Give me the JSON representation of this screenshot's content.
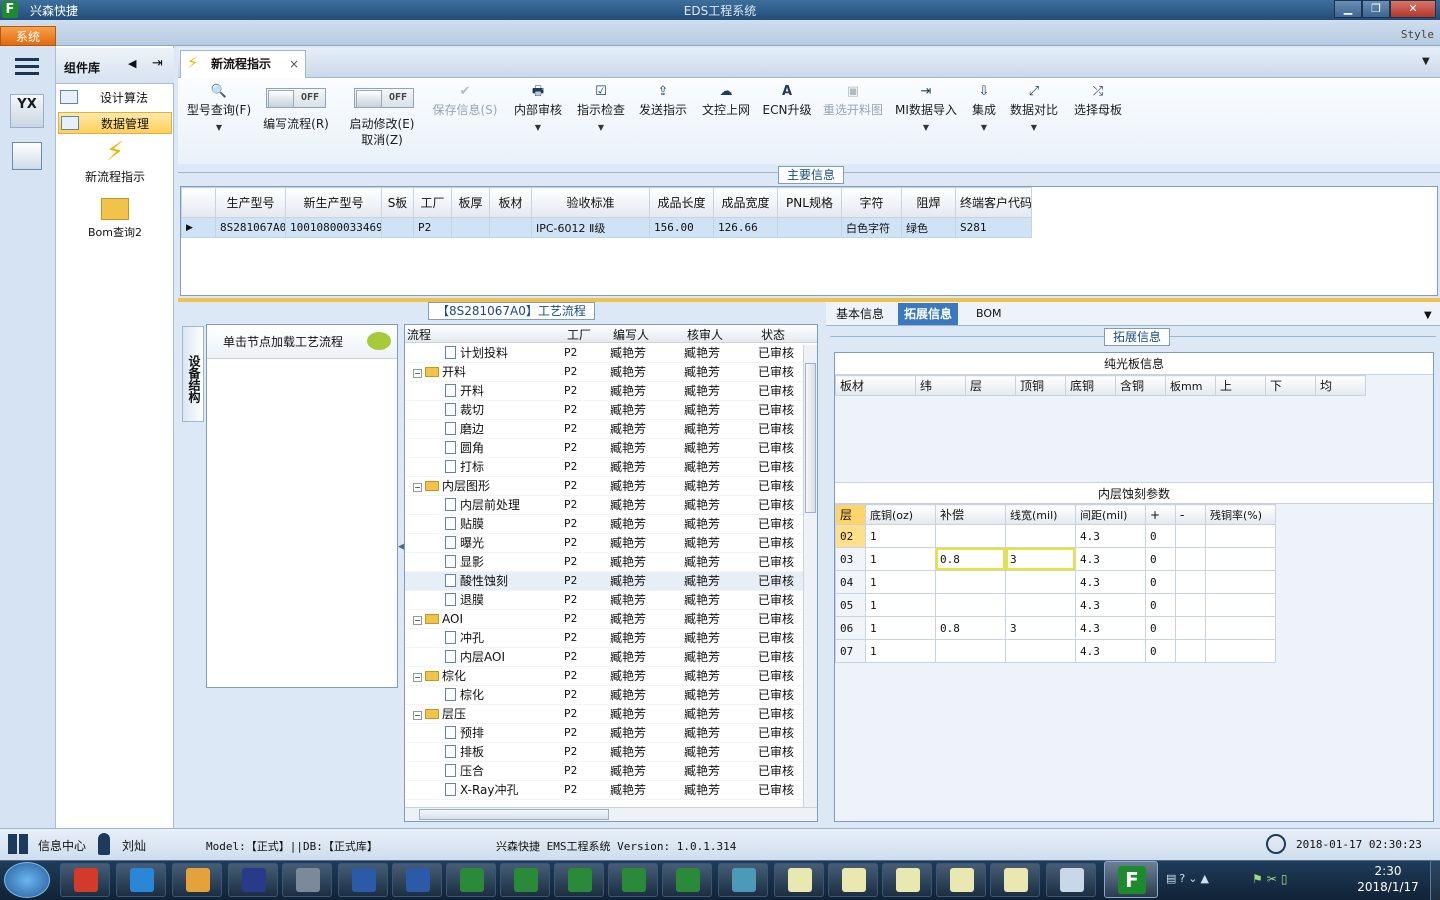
{
  "window": {
    "app_title": "兴森快捷",
    "center_title": "EDS工程系统",
    "icon_letter": "F"
  },
  "menubar": {
    "system_label": "系统",
    "style_label": "Style"
  },
  "left_rail": {
    "logo_text": "YX"
  },
  "component_panel": {
    "title": "组件库",
    "items": [
      {
        "label": "设计算法"
      },
      {
        "label": "数据管理"
      }
    ],
    "shortcuts": [
      {
        "label": "新流程指示"
      },
      {
        "label": "Bom查询2"
      }
    ]
  },
  "doc_tab": {
    "label": "新流程指示",
    "close": "×"
  },
  "ribbon": {
    "buttons": [
      {
        "label": "型号查询(F)",
        "icon": "🔍"
      },
      {
        "label": "编写流程(R)",
        "toggle": "OFF"
      },
      {
        "label": "启动修改(E)",
        "sub": "取消(Z)",
        "toggle": "OFF"
      },
      {
        "label": "保存信息(S)",
        "icon": "✔"
      },
      {
        "label": "内部审核",
        "icon": "🖶"
      },
      {
        "label": "指示检查",
        "icon": "☑"
      },
      {
        "label": "发送指示",
        "icon": "⇪"
      },
      {
        "label": "文控上网",
        "icon": "☁"
      },
      {
        "label": "ECN升级",
        "icon": "A"
      },
      {
        "label": "重选开料图",
        "icon": "▣"
      },
      {
        "label": "MI数据导入",
        "icon": "⇥"
      },
      {
        "label": "集成",
        "icon": "⇩"
      },
      {
        "label": "数据对比",
        "icon": "⤢"
      },
      {
        "label": "选择母板",
        "icon": "⤮"
      }
    ]
  },
  "main_info": {
    "title": "主要信息",
    "columns": [
      "生产型号",
      "新生产型号",
      "S板",
      "工厂",
      "板厚",
      "板材",
      "验收标准",
      "成品长度",
      "成品宽度",
      "PNL规格",
      "字符",
      "阻焊",
      "终端客户代码"
    ],
    "row": [
      "8S281067A0",
      "10010800033469",
      "",
      "P2",
      "",
      "",
      "IPC-6012 Ⅱ级",
      "156.00",
      "126.66",
      "",
      "白色字符",
      "绿色",
      "S281"
    ]
  },
  "process": {
    "title": "【8S281067A0】工艺流程",
    "side_tab": "设备结构",
    "hint": "单击节点加载工艺流程",
    "columns": [
      "流程",
      "工厂",
      "编写人",
      "核审人",
      "状态"
    ],
    "factory": "P2",
    "writer": "臧艳芳",
    "reviewer": "臧艳芳",
    "status": "已审核",
    "rows": [
      {
        "name": "计划投料",
        "level": 1
      },
      {
        "name": "开料",
        "level": 0
      },
      {
        "name": "开料",
        "level": 1
      },
      {
        "name": "裁切",
        "level": 1
      },
      {
        "name": "磨边",
        "level": 1
      },
      {
        "name": "圆角",
        "level": 1
      },
      {
        "name": "打标",
        "level": 1
      },
      {
        "name": "内层图形",
        "level": 0
      },
      {
        "name": "内层前处理",
        "level": 1
      },
      {
        "name": "贴膜",
        "level": 1
      },
      {
        "name": "曝光",
        "level": 1
      },
      {
        "name": "显影",
        "level": 1
      },
      {
        "name": "酸性蚀刻",
        "level": 1,
        "selected": true
      },
      {
        "name": "退膜",
        "level": 1
      },
      {
        "name": "AOI",
        "level": 0
      },
      {
        "name": "冲孔",
        "level": 1
      },
      {
        "name": "内层AOI",
        "level": 1
      },
      {
        "name": "棕化",
        "level": 0
      },
      {
        "name": "棕化",
        "level": 1
      },
      {
        "name": "层压",
        "level": 0
      },
      {
        "name": "预排",
        "level": 1
      },
      {
        "name": "排板",
        "level": 1
      },
      {
        "name": "压合",
        "level": 1
      },
      {
        "name": "X-Ray冲孔",
        "level": 1
      }
    ]
  },
  "right_tabs": [
    {
      "label": "基本信息"
    },
    {
      "label": "拓展信息",
      "active": true
    },
    {
      "label": "BOM"
    }
  ],
  "ext": {
    "title": "拓展信息",
    "pure": {
      "title": "纯光板信息",
      "columns": [
        "板材",
        "纬",
        "层",
        "顶铜",
        "底铜",
        "含铜",
        "板mm",
        "上",
        "下",
        "均"
      ]
    },
    "etch": {
      "title": "内层蚀刻参数",
      "columns": [
        "层",
        "底铜(oz)",
        "补偿",
        "线宽(mil)",
        "间距(mil)",
        "+",
        "-",
        "残铜率(%)"
      ],
      "rows": [
        [
          "02",
          "1",
          "",
          "",
          "4.3",
          "0",
          "",
          ""
        ],
        [
          "03",
          "1",
          "0.8",
          "3",
          "4.3",
          "0",
          "",
          ""
        ],
        [
          "04",
          "1",
          "",
          "",
          "4.3",
          "0",
          "",
          ""
        ],
        [
          "05",
          "1",
          "",
          "",
          "4.3",
          "0",
          "",
          ""
        ],
        [
          "06",
          "1",
          "0.8",
          "3",
          "4.3",
          "0",
          "",
          ""
        ],
        [
          "07",
          "1",
          "",
          "",
          "4.3",
          "0",
          "",
          ""
        ]
      ]
    }
  },
  "statusbar": {
    "info_center": "信息中心",
    "user": "刘灿",
    "model_db": "Model:【正式】||DB:【正式库】",
    "version": "兴森快捷 EMS工程系统 Version: 1.0.1.314",
    "datetime": "2018-01-17 02:30:23"
  },
  "taskbar": {
    "time": "2:30",
    "date": "2018/1/17"
  },
  "colors": {
    "accent": "#1e8a2e",
    "selection": "#cfe3f7",
    "highlight_box": "#e6e62a",
    "orange": "#e06a10"
  }
}
